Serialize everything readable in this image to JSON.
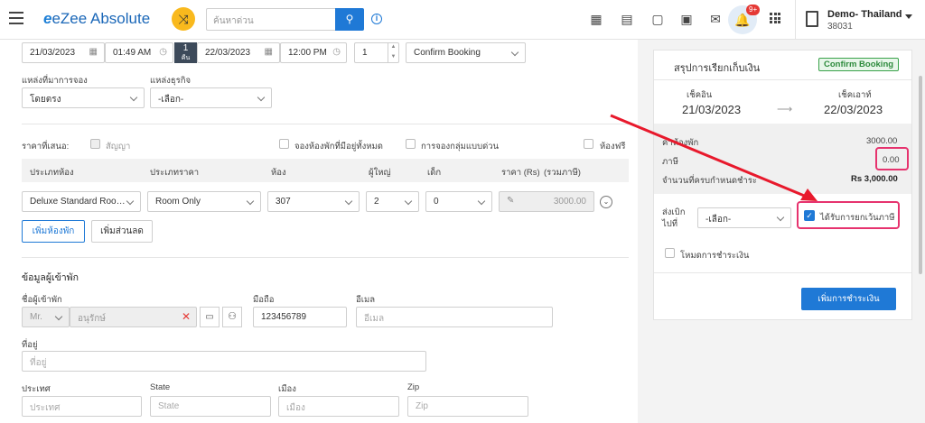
{
  "header": {
    "app_name": "eZee Absolute",
    "search_placeholder": "ค้นหาด่วน",
    "notification_count": "9+",
    "hotel_name": "Demo- Thailand",
    "hotel_id": "38031"
  },
  "booking": {
    "checkin_date": "21/03/2023",
    "checkin_time": "01:49 AM",
    "nights": "1",
    "nights_unit": "คืน",
    "checkout_date": "22/03/2023",
    "checkout_time": "12:00 PM",
    "rooms_count": "1",
    "status": "Confirm Booking",
    "source_label": "แหล่งที่มาการจอง",
    "source_value": "โดยตรง",
    "business_label": "แหล่งธุรกิจ",
    "business_value": "-เลือก-",
    "rate_offer_label": "ราคาที่เสนอ:",
    "contract_label": "สัญญา",
    "book_all_label": "จองห้องพักที่มีอยู่ทั้งหมด",
    "quick_group_label": "การจองกลุ่มแบบด่วน",
    "free_room_label": "ห้องฟรี",
    "columns": [
      "ประเภทห้อง",
      "ประเภทราคา",
      "ห้อง",
      "ผู้ใหญ่",
      "เด็ก",
      "ราคา (Rs)",
      "(รวมภาษี)"
    ],
    "row": {
      "room_type": "Deluxe Standard Roo…",
      "rate_type": "Room Only",
      "room": "307",
      "adults": "2",
      "children": "0",
      "price": "3000.00"
    },
    "add_room_button": "เพิ่มห้องพัก",
    "add_discount_button": "เพิ่มส่วนลด"
  },
  "guest": {
    "section_title": "ข้อมูลผู้เข้าพัก",
    "name_label": "ชื่อผู้เข้าพัก",
    "salutation": "Mr.",
    "name_value": "อนุรักษ์",
    "mobile_label": "มือถือ",
    "mobile_value": "123456789",
    "email_label": "อีเมล",
    "email_placeholder": "อีเมล",
    "address_label": "ที่อยู่",
    "address_placeholder": "ที่อยู่",
    "country_label": "ประเทศ",
    "country_placeholder": "ประเทศ",
    "state_label": "State",
    "state_placeholder": "State",
    "city_label": "เมือง",
    "city_placeholder": "เมือง",
    "zip_label": "Zip",
    "zip_placeholder": "Zip"
  },
  "summary": {
    "title": "สรุปการเรียกเก็บเงิน",
    "status": "Confirm Booking",
    "checkin_label": "เช็คอิน",
    "checkin_date": "21/03/2023",
    "checkout_label": "เช็คเอาท์",
    "checkout_date": "22/03/2023",
    "room_rate_label": "ค่าห้องพัก",
    "room_rate_value": "3000.00",
    "tax_label": "ภาษี",
    "tax_value": "0.00",
    "due_label": "จำนวนที่ครบกำหนดชำระ",
    "due_value": "Rs 3,000.00",
    "send_to_label": "ส่งเบิก\nไปที่",
    "send_to_value": "-เลือก-",
    "tax_exempt_label": "ได้รับการยกเว้นภาษี",
    "payment_mode_label": "โหมดการชำระเงิน",
    "add_payment_button": "เพิ่มการชำระเงิน"
  },
  "colors": {
    "accent": "#1f79d6",
    "highlight": "#e6336e",
    "arrow": "#e8192c",
    "status_green": "#39a24a"
  }
}
